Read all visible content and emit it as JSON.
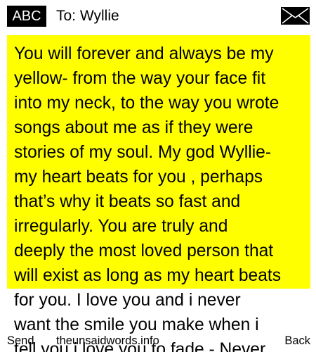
{
  "header": {
    "mode_label": "ABC",
    "recipient": "To: Wyllie",
    "envelope_icon": "envelope-icon"
  },
  "message": {
    "highlight_color": "#ffff00",
    "lines": [
      "You will forever and always be my",
      "yellow- from the way your face fit",
      "into my neck, to the way you wrote",
      "songs about me as if they were",
      "stories of my soul. My god Wyllie-",
      "my heart beats for you , perhaps",
      "that’s why it beats so fast and",
      "irregularly. You are truly and",
      "deeply the most loved person that",
      "will exist as long as my heart beats",
      "for you. I love you and i never",
      "want the smile you make when i",
      "tell you i love you to fade - Never"
    ]
  },
  "softkeys": {
    "left": "Send",
    "center": "theunsaidwords.info",
    "right": "Back"
  }
}
